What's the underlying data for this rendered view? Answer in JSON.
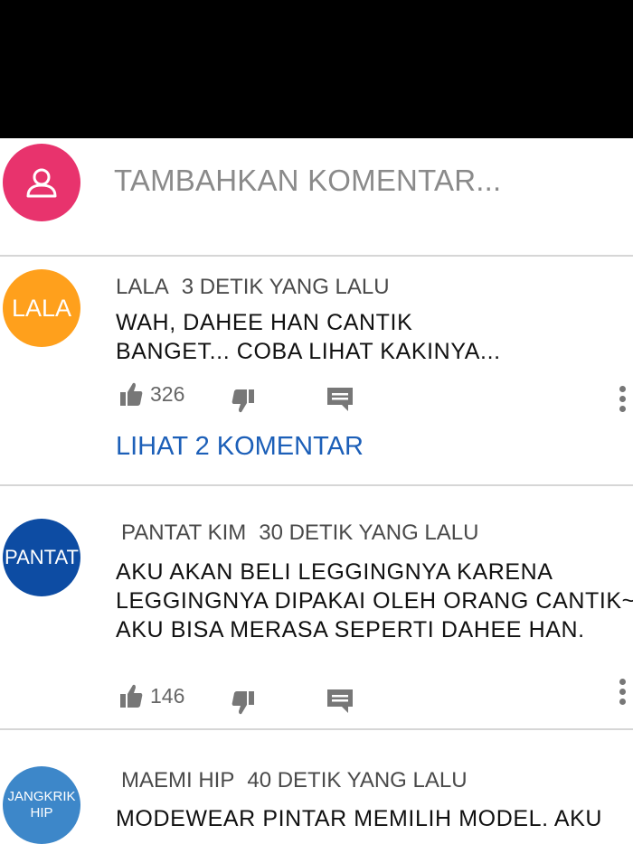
{
  "add_comment": {
    "placeholder": "TAMBAHKAN KOMENTAR..."
  },
  "comments": [
    {
      "avatar_text": "LALA",
      "avatar_color": "#ffa01c",
      "author": "LALA",
      "time": "3 DETIK YANG LALU",
      "lines": [
        "WAH, DAHEE HAN CANTIK",
        "BANGET... COBA LIHAT KAKINYA..."
      ],
      "likes": "326",
      "replies_link": "LIHAT 2 KOMENTAR"
    },
    {
      "avatar_text": "PANTAT",
      "avatar_color": "#0d4ca3",
      "author": "PANTAT KIM",
      "time": "30 DETIK YANG LALU",
      "lines": [
        "AKU AKAN BELI LEGGINGNYA KARENA",
        "LEGGINGNYA DIPAKAI OLEH ORANG CANTIK~",
        "AKU BISA MERASA SEPERTI DAHEE HAN."
      ],
      "likes": "146"
    },
    {
      "avatar_text": [
        "JANGKRIK",
        "HIP"
      ],
      "avatar_color": "#3d87c9",
      "author": "MAEMI HIP",
      "time": "40 DETIK YANG LALU",
      "lines": [
        "MODEWEAR PINTAR MEMILIH MODEL. AKU"
      ]
    }
  ]
}
